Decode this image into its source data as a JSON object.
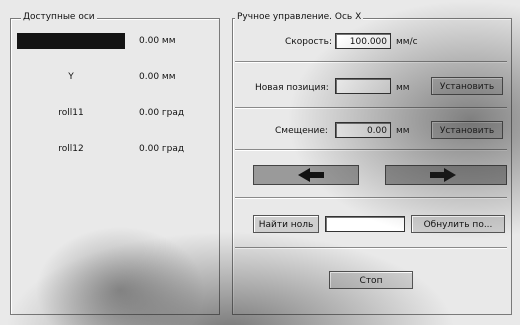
{
  "axes_panel": {
    "title": "Доступные оси",
    "axes": [
      {
        "name": "",
        "value": "0.00 мм"
      },
      {
        "name": "Y",
        "value": "0.00 мм"
      },
      {
        "name": "roll11",
        "value": "0.00 град"
      },
      {
        "name": "roll12",
        "value": "0.00 град"
      }
    ]
  },
  "manual_panel": {
    "title": "Ручное управление. Ось X",
    "speed_label": "Скорость:",
    "speed_value": "100.000",
    "speed_unit": "мм/с",
    "new_pos_label": "Новая позиция:",
    "new_pos_value": "",
    "new_pos_unit": "мм",
    "set_button": "Установить",
    "offset_label": "Смещение:",
    "offset_value": "0.00",
    "offset_unit": "мм",
    "offset_button": "Установить",
    "zero_button": "Найти ноль",
    "zero_field": "",
    "reset_button": "Обнулить по...",
    "stop_button": "Стоп"
  }
}
